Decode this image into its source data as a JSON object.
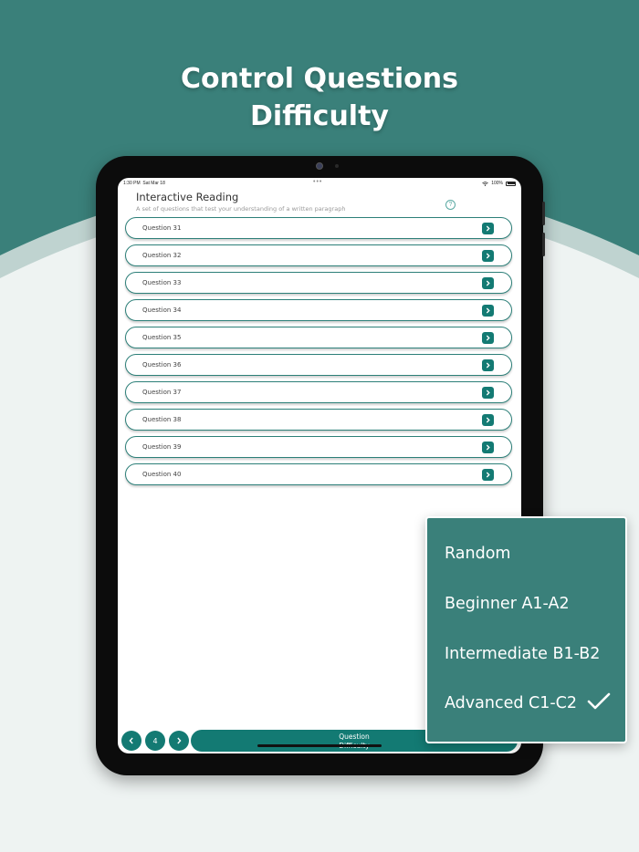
{
  "headline": {
    "line1": "Control Questions",
    "line2": "Difficulty"
  },
  "colors": {
    "teal_bg": "#3a807a",
    "button_teal": "#137a73",
    "page_light": "#eef3f2"
  },
  "device": {
    "status_time": "1:30 PM",
    "status_date": "Sat Mar 18",
    "status_battery": "100%"
  },
  "screen": {
    "title": "Interactive Reading",
    "subtitle": "A set of questions that test your understanding of a written paragraph",
    "help_icon": "question-circle-icon",
    "questions": [
      {
        "label": "Question 31"
      },
      {
        "label": "Question 32"
      },
      {
        "label": "Question 33"
      },
      {
        "label": "Question 34"
      },
      {
        "label": "Question 35"
      },
      {
        "label": "Question 36"
      },
      {
        "label": "Question 37"
      },
      {
        "label": "Question 38"
      },
      {
        "label": "Question 39"
      },
      {
        "label": "Question 40"
      }
    ],
    "pagination": {
      "prev_icon": "chevron-left-icon",
      "page_number": "4",
      "next_icon": "chevron-right-icon"
    },
    "difficulty_button": {
      "line1": "Question",
      "line2": "Difficulty"
    }
  },
  "dropdown": {
    "options": [
      {
        "label": "Random",
        "selected": false
      },
      {
        "label": "Beginner A1-A2",
        "selected": false
      },
      {
        "label": "Intermediate B1-B2",
        "selected": false
      },
      {
        "label": "Advanced C1-C2",
        "selected": true
      }
    ],
    "check_icon": "checkmark-icon"
  }
}
